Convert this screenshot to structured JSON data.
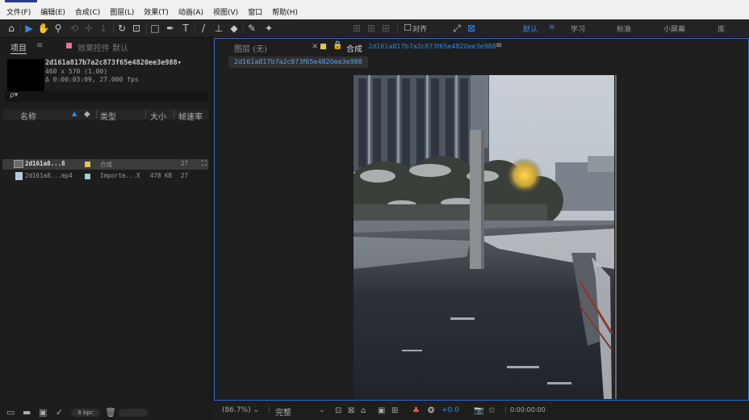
{
  "menubar": {
    "items": [
      "文件(F)",
      "编辑(E)",
      "合成(C)",
      "图层(L)",
      "效果(T)",
      "动画(A)",
      "视图(V)",
      "窗口",
      "帮助(H)"
    ]
  },
  "toolbar": {
    "align_label": "对齐",
    "workspaces": [
      "默认",
      "学习",
      "标准",
      "小屏幕",
      "库"
    ],
    "active_workspace": "默认"
  },
  "project_panel": {
    "tab_label": "项目",
    "effects_tab_label": "效果控件 默认",
    "selected_item": {
      "name": "2d161a817b7a2c873f65e4820ee3e988",
      "dimensions": "460 x 570 (1.00)",
      "duration": "Δ 0:00:03:09, 27.000 fps"
    },
    "search_placeholder": "ρ▾",
    "columns": [
      "名称",
      "类型",
      "大小",
      "帧速率"
    ],
    "rows": [
      {
        "name": "2d161a8...8",
        "type": "合成",
        "size": "",
        "fps": "27",
        "selected": true
      },
      {
        "name": "2d161a8...mp4",
        "type": "Importe...X",
        "size": "478 KB",
        "fps": "27",
        "selected": false
      }
    ],
    "bpc_label": "8 bpc"
  },
  "comp_panel": {
    "layer_tab": "图层 (无)",
    "comp_tab_prefix": "合成",
    "comp_name": "2d161a817b7a2c873f65e4820ee3e988",
    "breadcrumb": "2d161a817b7a2c873f65e4820ee3e988",
    "zoom": "(86.7%)",
    "quality": "完整",
    "exposure": "+0.0",
    "timecode": "0:00:00:00"
  },
  "colors": {
    "accent": "#2d8ceb",
    "comp_label": "#e8c545",
    "video_label": "#9ad6d6",
    "panel_border": "#2d6cc9"
  }
}
